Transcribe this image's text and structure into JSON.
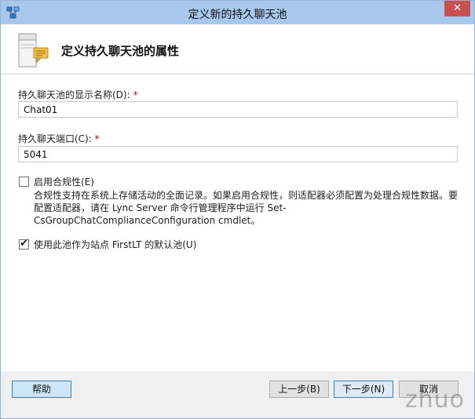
{
  "window": {
    "title": "定义新的持久聊天池",
    "close_glyph": "✕"
  },
  "header": {
    "title": "定义持久聊天池的属性",
    "icon": "server-chat-icon"
  },
  "form": {
    "display_name_label": "持久聊天池的显示名称(D):",
    "display_name_value": "Chat01",
    "port_label": "持久聊天端口(C):",
    "port_value": "5041",
    "required_mark": "*",
    "compliance_label": "启用合规性(E)",
    "compliance_checked": false,
    "compliance_desc": "合规性支持在系统上存储活动的全面记录。如果启用合规性，则适配器必须配置为处理合规性数据。要配置适配器，请在 Lync Server 命令行管理程序中运行 Set-CsGroupChatComplianceConfiguration cmdlet。",
    "default_pool_label": "使用此池作为站点 FirstLT 的默认池(U)",
    "default_pool_checked": true,
    "check_glyph": "✔"
  },
  "footer": {
    "help": "帮助",
    "back": "上一步(B)",
    "next": "下一步(N)",
    "cancel": "取消",
    "watermark": "zhuo"
  }
}
